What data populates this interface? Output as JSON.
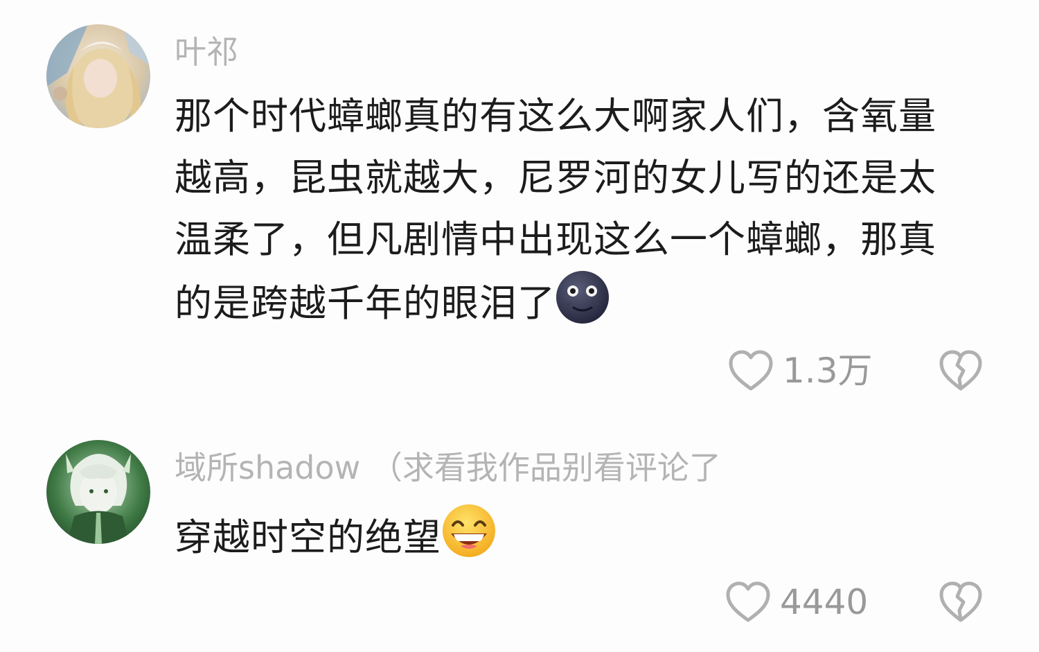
{
  "comments": [
    {
      "username": "叶祁",
      "text": "那个时代蟑螂真的有这么大啊家人们，含氧量越高，昆虫就越大，尼罗河的女儿写的还是太温柔了，但凡剧情中出现这么一个蟑螂，那真的是跨越千年的眼泪了",
      "emoji": "new-moon-face-emoji",
      "likes": "1.3万"
    },
    {
      "username": "域所shadow （求看我作品别看评论了",
      "text": "穿越时空的绝望",
      "emoji": "grinning-face-emoji",
      "likes": "4440"
    }
  ],
  "icons": {
    "like": "heart-outline-icon",
    "dislike": "broken-heart-icon"
  },
  "colors": {
    "background": "#fdfdfd",
    "username": "#b4b4b4",
    "text": "#1c1c1c",
    "count": "#999999"
  }
}
